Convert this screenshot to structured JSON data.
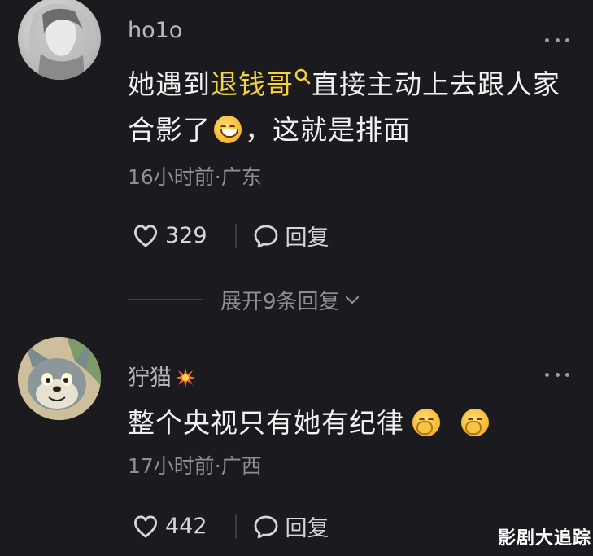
{
  "comments": [
    {
      "username": "ho1o",
      "text_pre": "她遇到",
      "text_highlight": "退钱哥",
      "text_mid": "直接主动上去跟人家合影了",
      "text_post": "，这就是排面",
      "meta": "16小时前·广东",
      "like_count": "329",
      "reply_label": "回复"
    },
    {
      "username": "狞猫",
      "text": "整个央视只有她有纪律",
      "meta": "17小时前·广西",
      "like_count": "442",
      "reply_label": "回复"
    }
  ],
  "expand_replies_label": "展开9条回复",
  "watermark": "影剧大追踪",
  "colors": {
    "background": "#1a1a1f",
    "highlight": "#f5d33a"
  },
  "icons": [
    "heart-icon",
    "comment-bubble-icon",
    "more-dots-icon",
    "search-icon",
    "chevron-down-icon",
    "explosion-badge-icon",
    "grin-emoji",
    "giggle-emoji"
  ]
}
